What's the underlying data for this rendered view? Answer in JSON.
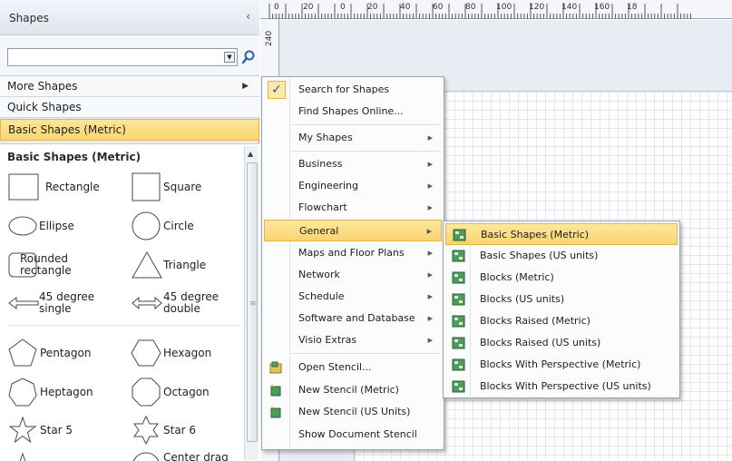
{
  "shapes_pane": {
    "title": "Shapes",
    "collapse_glyph": "‹",
    "search": {
      "value": "",
      "placeholder": ""
    },
    "rows": {
      "more": "More Shapes",
      "quick": "Quick Shapes",
      "basic": "Basic Shapes (Metric)"
    },
    "stencil_title": "Basic Shapes (Metric)",
    "shapes": [
      {
        "label": "Rectangle",
        "icon": "rectangle-shape-icon"
      },
      {
        "label": "Square",
        "icon": "square-shape-icon"
      },
      {
        "label": "Ellipse",
        "icon": "ellipse-shape-icon"
      },
      {
        "label": "Circle",
        "icon": "circle-shape-icon"
      },
      {
        "label": "Rounded rectangle",
        "icon": "rounded-rectangle-shape-icon"
      },
      {
        "label": "Triangle",
        "icon": "triangle-shape-icon"
      },
      {
        "label": "45 degree single",
        "icon": "single-arrow-shape-icon"
      },
      {
        "label": "45 degree double",
        "icon": "double-arrow-shape-icon"
      },
      {
        "label": "Pentagon",
        "icon": "pentagon-shape-icon"
      },
      {
        "label": "Hexagon",
        "icon": "hexagon-shape-icon"
      },
      {
        "label": "Heptagon",
        "icon": "heptagon-shape-icon"
      },
      {
        "label": "Octagon",
        "icon": "octagon-shape-icon"
      },
      {
        "label": "Star 5",
        "icon": "star5-shape-icon"
      },
      {
        "label": "Star 6",
        "icon": "star6-shape-icon"
      },
      {
        "label": "Center drag",
        "icon": "center-drag-shape-icon"
      }
    ]
  },
  "rulers": {
    "top_ticks": [
      "0",
      "20",
      "0",
      "20",
      "40",
      "60",
      "80",
      "100",
      "120",
      "140",
      "160",
      "18"
    ],
    "left_label": "240"
  },
  "more_shapes_menu": {
    "items": [
      {
        "label": "Search for Shapes",
        "mnemonic": "S",
        "checked": true
      },
      {
        "label": "Find Shapes Online...",
        "mnemonic": "F"
      },
      {
        "label": "My Shapes",
        "mnemonic": "M",
        "submenu": true
      },
      {
        "label": "Business",
        "submenu": true
      },
      {
        "label": "Engineering",
        "submenu": true
      },
      {
        "label": "Flowchart",
        "submenu": true
      },
      {
        "label": "General",
        "submenu": true,
        "highlighted": true
      },
      {
        "label": "Maps and Floor Plans",
        "submenu": true
      },
      {
        "label": "Network",
        "submenu": true
      },
      {
        "label": "Schedule",
        "submenu": true
      },
      {
        "label": "Software and Database",
        "submenu": true
      },
      {
        "label": "Visio Extras",
        "submenu": true
      },
      {
        "label": "Open Stencil...",
        "mnemonic": "O",
        "icon": "open-stencil-icon"
      },
      {
        "label": "New Stencil (Metric)",
        "mnemonic": "N",
        "icon": "new-stencil-icon"
      },
      {
        "label": "New Stencil (US Units)",
        "mnemonic": "e",
        "icon": "new-stencil-icon"
      },
      {
        "label": "Show Document Stencil",
        "mnemonic": "D"
      }
    ]
  },
  "general_submenu": {
    "items": [
      {
        "label": "Basic Shapes (Metric)",
        "highlighted": true
      },
      {
        "label": "Basic Shapes (US units)"
      },
      {
        "label": "Blocks (Metric)"
      },
      {
        "label": "Blocks (US units)"
      },
      {
        "label": "Blocks Raised (Metric)"
      },
      {
        "label": "Blocks Raised (US units)"
      },
      {
        "label": "Blocks With Perspective (Metric)"
      },
      {
        "label": "Blocks With Perspective (US units)"
      }
    ]
  },
  "colors": {
    "highlight": "#fbd671",
    "highlight_border": "#e2b54e",
    "pane_bg": "#e9edf3",
    "stencil_icon": "#2e8b57"
  }
}
